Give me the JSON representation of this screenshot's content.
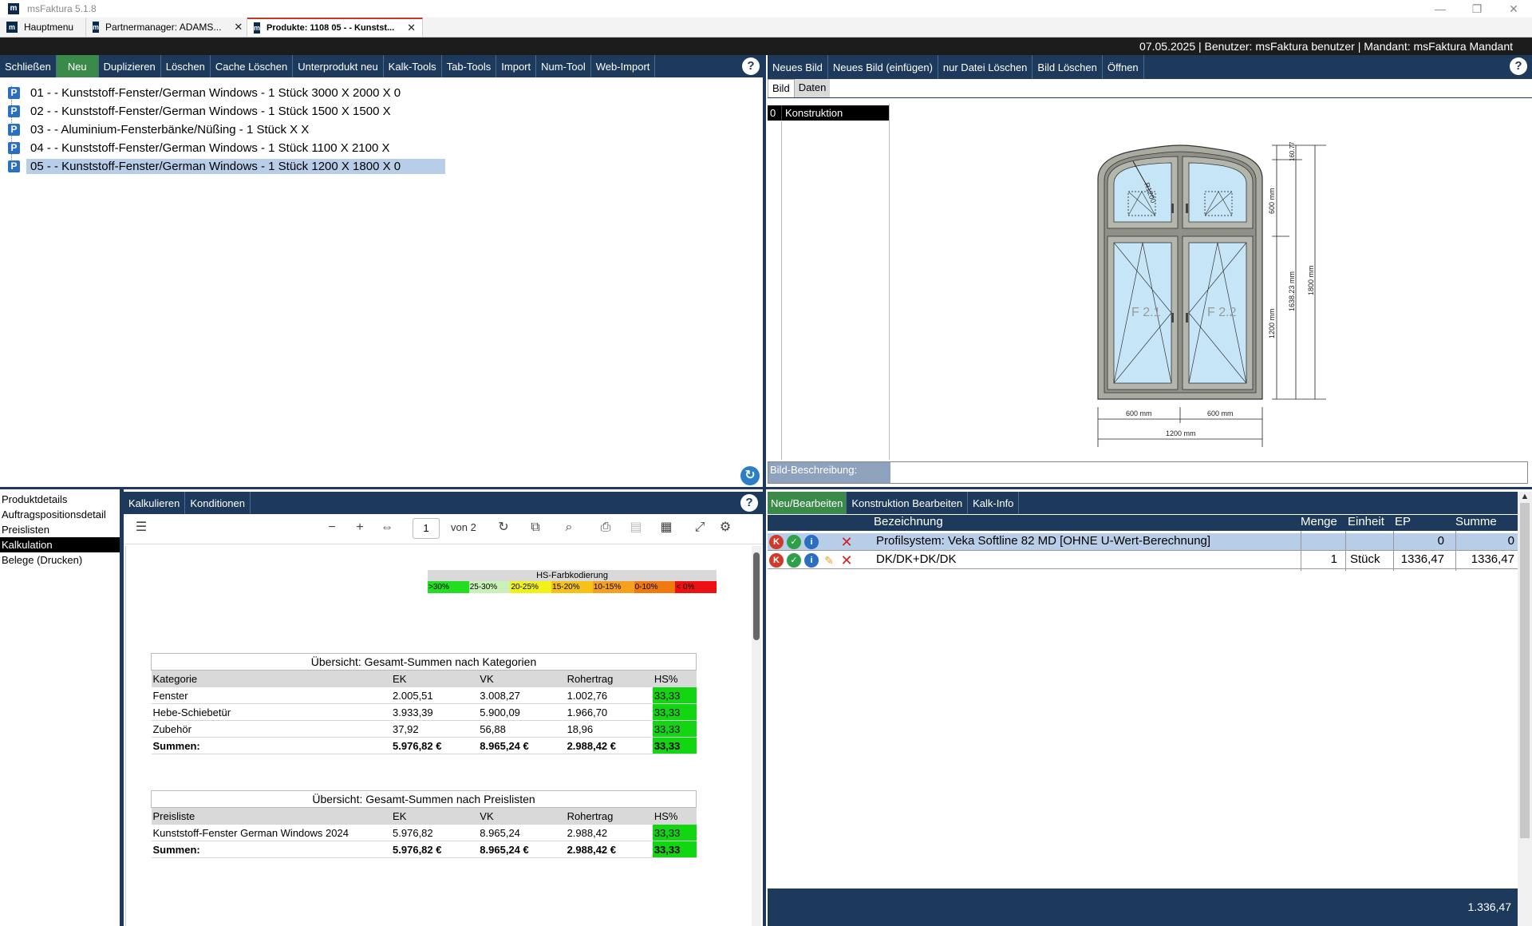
{
  "titlebar": {
    "title": "msFaktura 5.1.8",
    "logo": "m"
  },
  "tabs": [
    {
      "label": "Hauptmenu"
    },
    {
      "label": "Partnermanager: ADAMS..."
    },
    {
      "label": "Produkte: 1108 05 -  - Kunstst..."
    }
  ],
  "status": {
    "text": "07.05.2025 | Benutzer: msFaktura benutzer | Mandant: msFaktura Mandant"
  },
  "left_toolbar": [
    "Schließen",
    "Neu",
    "Duplizieren",
    "Löschen",
    "Cache Löschen",
    "Unterprodukt neu",
    "Kalk-Tools",
    "Tab-Tools",
    "Import",
    "Num-Tool",
    "Web-Import"
  ],
  "tree": [
    "01 -  - Kunststoff-Fenster/German Windows - 1 Stück 3000 X 2000 X 0",
    "02 - - Kunststoff-Fenster/German Windows - 1 Stück 1500 X 1500 X",
    "03 - - Aluminium-Fensterbänke/Nüßing - 1 Stück X X",
    "04 - - Kunststoff-Fenster/German Windows - 1 Stück 1100 X 2100 X",
    "05 -  - Kunststoff-Fenster/German Windows - 1 Stück 1200 X 1800 X 0"
  ],
  "right_toolbar": [
    "Neues Bild",
    "Neues Bild (einfügen)",
    "nur Datei Löschen",
    "Bild Löschen",
    "Öffnen"
  ],
  "image_tabs": [
    "Bild",
    "Daten"
  ],
  "image_list": [
    {
      "index": "0",
      "name": "Konstruktion"
    }
  ],
  "drawing": {
    "labels": [
      "F 2.1",
      "F 2.2",
      "600 mm",
      "600 mm",
      "1200 mm",
      "600 mm",
      "1200 mm",
      "1638.23 mm",
      "1800 mm",
      "160.77",
      "R1200"
    ]
  },
  "bild_beschreibung": "Bild-Beschreibung:",
  "left_nav": [
    "Produktdetails",
    "Auftragspositionsdetail",
    "Preislisten",
    "Kalkulation",
    "Belege (Drucken)"
  ],
  "kalk_tabs": [
    "Kalkulieren",
    "Konditionen"
  ],
  "pdf": {
    "page": "1",
    "of": "von 2"
  },
  "legend": {
    "title": "HS-Farbkodierung",
    "items": [
      {
        "label": ">30%",
        "color": "#22dd22"
      },
      {
        "label": "25-30%",
        "color": "#c8f0b8"
      },
      {
        "label": "20-25%",
        "color": "#f2f21a"
      },
      {
        "label": "15-20%",
        "color": "#f5c21a"
      },
      {
        "label": "10-15%",
        "color": "#f5a020"
      },
      {
        "label": "0-10%",
        "color": "#f07a10"
      },
      {
        "label": "< 0%",
        "color": "#ee1111"
      }
    ]
  },
  "table1": {
    "caption": "Übersicht: Gesamt-Summen nach Kategorien",
    "headers": [
      "Kategorie",
      "EK",
      "VK",
      "Rohertrag",
      "HS%"
    ],
    "rows": [
      [
        "Fenster",
        "2.005,51",
        "3.008,27",
        "1.002,76",
        "33,33"
      ],
      [
        "Hebe-Schiebetür",
        "3.933,39",
        "5.900,09",
        "1.966,70",
        "33,33"
      ],
      [
        "Zubehör",
        "37,92",
        "56,88",
        "18,96",
        "33,33"
      ],
      [
        "Summen:",
        "5.976,82 €",
        "8.965,24 €",
        "2.988,42 €",
        "33,33"
      ]
    ]
  },
  "table2": {
    "caption": "Übersicht: Gesamt-Summen nach Preislisten",
    "headers": [
      "Preisliste",
      "EK",
      "VK",
      "Rohertrag",
      "HS%"
    ],
    "rows": [
      [
        "Kunststoff-Fenster German Windows 2024",
        "5.976,82",
        "8.965,24",
        "2.988,42",
        "33,33"
      ],
      [
        "Summen:",
        "5.976,82 €",
        "8.965,24 €",
        "2.988,42 €",
        "33,33"
      ]
    ]
  },
  "br_tabs": [
    "Neu/Bearbeiten",
    "Konstruktion Bearbeiten",
    "Kalk-Info"
  ],
  "grid": {
    "headers": {
      "bez": "Bezeichnung",
      "menge": "Menge",
      "einheit": "Einheit",
      "ep": "EP",
      "summe": "Summe"
    },
    "rows": [
      {
        "bez": "Profilsystem: Veka Softline 82 MD [OHNE U-Wert-Berechnung]",
        "menge": "",
        "einheit": "",
        "ep": "0",
        "summe": "0"
      },
      {
        "bez": "DK/DK+DK/DK",
        "menge": "1",
        "einheit": "Stück",
        "ep": "1336,47",
        "summe": "1336,47"
      }
    ],
    "total": "1.336,47"
  }
}
